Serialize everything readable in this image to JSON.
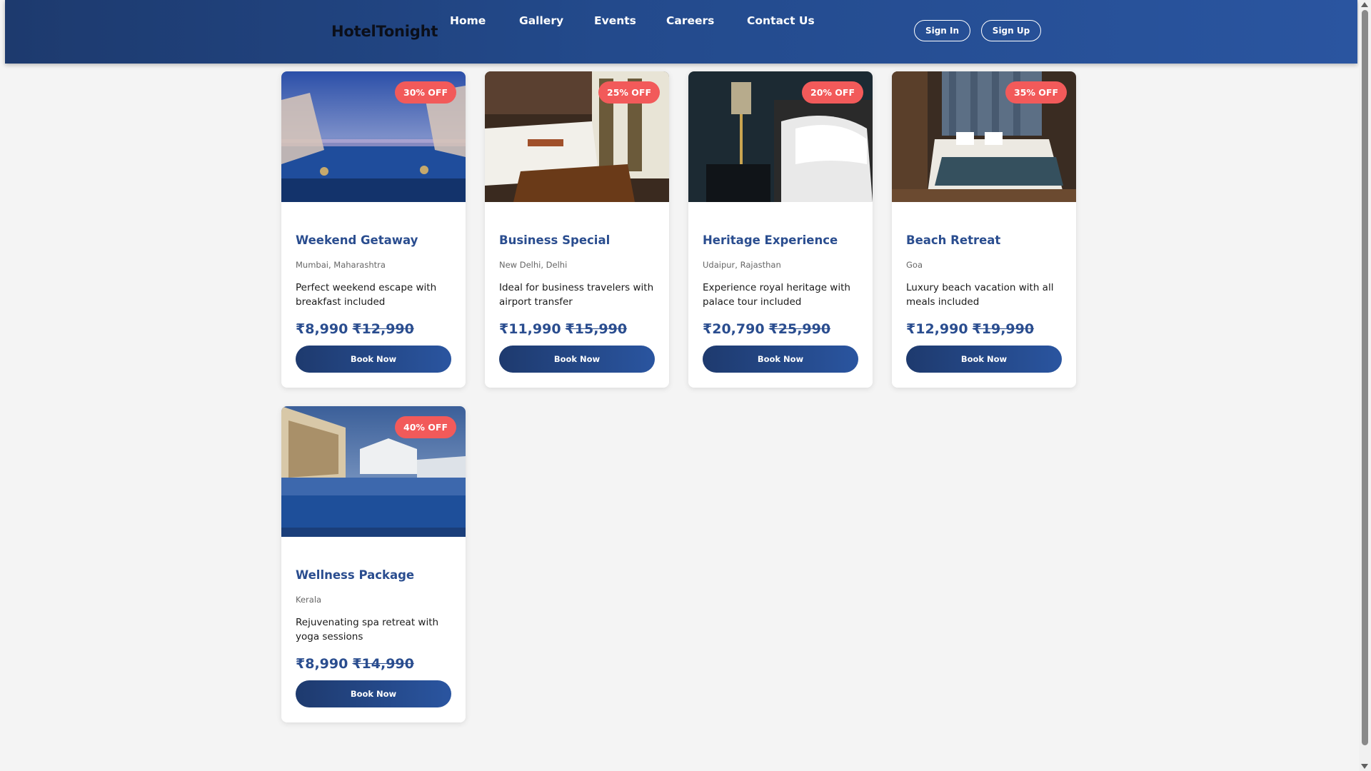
{
  "header": {
    "logo": "HotelTonight",
    "nav": [
      "Home",
      "Gallery",
      "Events",
      "Careers",
      "Contact Us"
    ],
    "sign_in": "Sign In",
    "sign_up": "Sign Up"
  },
  "colors": {
    "header_gradient": [
      "#1d3a6e",
      "#2a55a0"
    ],
    "badge": "#f25a5a",
    "title": "#2a4d8f",
    "button": "#234a8c",
    "background": "#f4f4f4"
  },
  "offers": [
    {
      "badge": "30% OFF",
      "title": "Weekend Getaway",
      "location": "Mumbai, Maharashtra",
      "description": "Perfect weekend escape with breakfast included",
      "price": "₹8,990",
      "old_price": "₹12,990",
      "button": "Book Now",
      "image": "resort-pool-dusk"
    },
    {
      "badge": "25% OFF",
      "title": "Business Special",
      "location": "New Delhi, Delhi",
      "description": "Ideal for business travelers with airport transfer",
      "price": "₹11,990",
      "old_price": "₹15,990",
      "button": "Book Now",
      "image": "bedroom-wooden-bench"
    },
    {
      "badge": "20% OFF",
      "title": "Heritage Experience",
      "location": "Udaipur, Rajasthan",
      "description": "Experience royal heritage with palace tour included",
      "price": "₹20,790",
      "old_price": "₹25,990",
      "button": "Book Now",
      "image": "bedside-lamp-pillows"
    },
    {
      "badge": "35% OFF",
      "title": "Beach Retreat",
      "location": "Goa",
      "description": "Luxury beach vacation with all meals included",
      "price": "₹12,990",
      "old_price": "₹19,990",
      "button": "Book Now",
      "image": "luxury-suite-bed"
    },
    {
      "badge": "40% OFF",
      "title": "Wellness Package",
      "location": "Kerala",
      "description": "Rejuvenating spa retreat with yoga sessions",
      "price": "₹8,990",
      "old_price": "₹14,990",
      "button": "Book Now",
      "image": "villa-pool-evening"
    }
  ]
}
